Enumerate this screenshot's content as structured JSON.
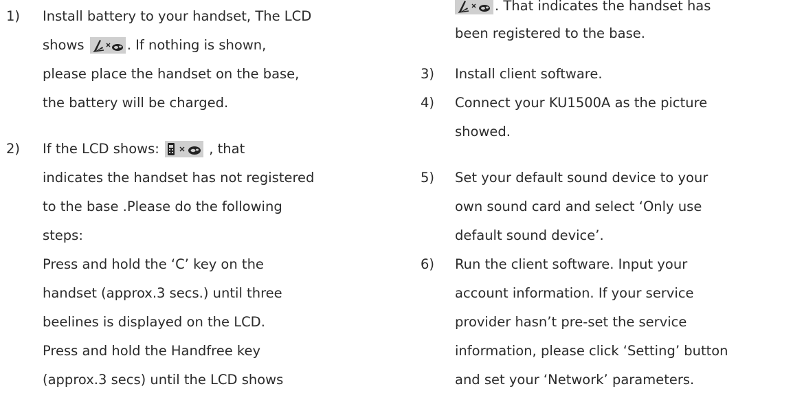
{
  "left": {
    "step1": {
      "number": "1)",
      "line1": "Install battery to your handset, The LCD",
      "line2_pre": "shows ",
      "line2_post": ". If nothing is shown,",
      "line3": "please place the handset on the base,",
      "line4": "the battery will be charged."
    },
    "step2": {
      "number": "2)",
      "line1_pre": "If the LCD shows: ",
      "line1_post": " , that",
      "line2": "indicates the handset has not registered",
      "line3": "to the base .Please do the following",
      "line4": "steps:",
      "line5": "Press and hold the ‘C’ key on the",
      "line6": "handset (approx.3 secs.) until three",
      "line7": "beelines is displayed on the LCD.",
      "line8": "Press and hold the Handfree key",
      "line9": "(approx.3 secs) until the LCD shows"
    }
  },
  "right": {
    "cont": {
      "line1_post": ". That indicates the handset has",
      "line2": "been registered to the base."
    },
    "step3": {
      "number": "3)",
      "line1": "Install client software."
    },
    "step4": {
      "number": "4)",
      "line1": "Connect your KU1500A as the picture",
      "line2": "showed."
    },
    "step5": {
      "number": "5)",
      "line1": "Set your default sound device to your",
      "line2": "own sound card and select ‘Only use",
      "line3": "default sound device’."
    },
    "step6": {
      "number": "6)",
      "line1": "Run the client software. Input your",
      "line2": "account information. If your service",
      "line3": "provider hasn’t pre-set the service",
      "line4": "information, please click ‘Setting’ button",
      "line5": "and set your ‘Network’ parameters."
    }
  },
  "icons": {
    "registered": "pen-signal-x-link-icon",
    "unregistered": "handset-x-link-icon"
  }
}
